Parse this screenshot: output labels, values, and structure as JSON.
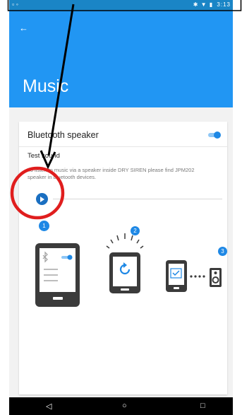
{
  "status_bar": {
    "left_icons": [
      "image-icon",
      "android-icon"
    ],
    "right_icons": [
      "bluetooth-icon",
      "wifi-icon",
      "battery-icon"
    ],
    "time": "3:13"
  },
  "app_bar": {
    "back_icon": "arrow-left-icon",
    "title": "Music"
  },
  "card": {
    "title": "Bluetooth speaker",
    "toggle_on": true,
    "test_sound_label": "Test sound",
    "help_text": "To listen to music via a speaker inside DRY SIREN please find JPM202 speaker in bluetooth devices.",
    "steps": [
      "1",
      "2",
      "3"
    ]
  },
  "nav_bar": {
    "back": "◁",
    "home": "○",
    "recents": "□"
  },
  "colors": {
    "status_bar": "#1a85c6",
    "app_bar": "#2196f3",
    "accent": "#1e88e5",
    "annotation": "#e01e1e"
  }
}
